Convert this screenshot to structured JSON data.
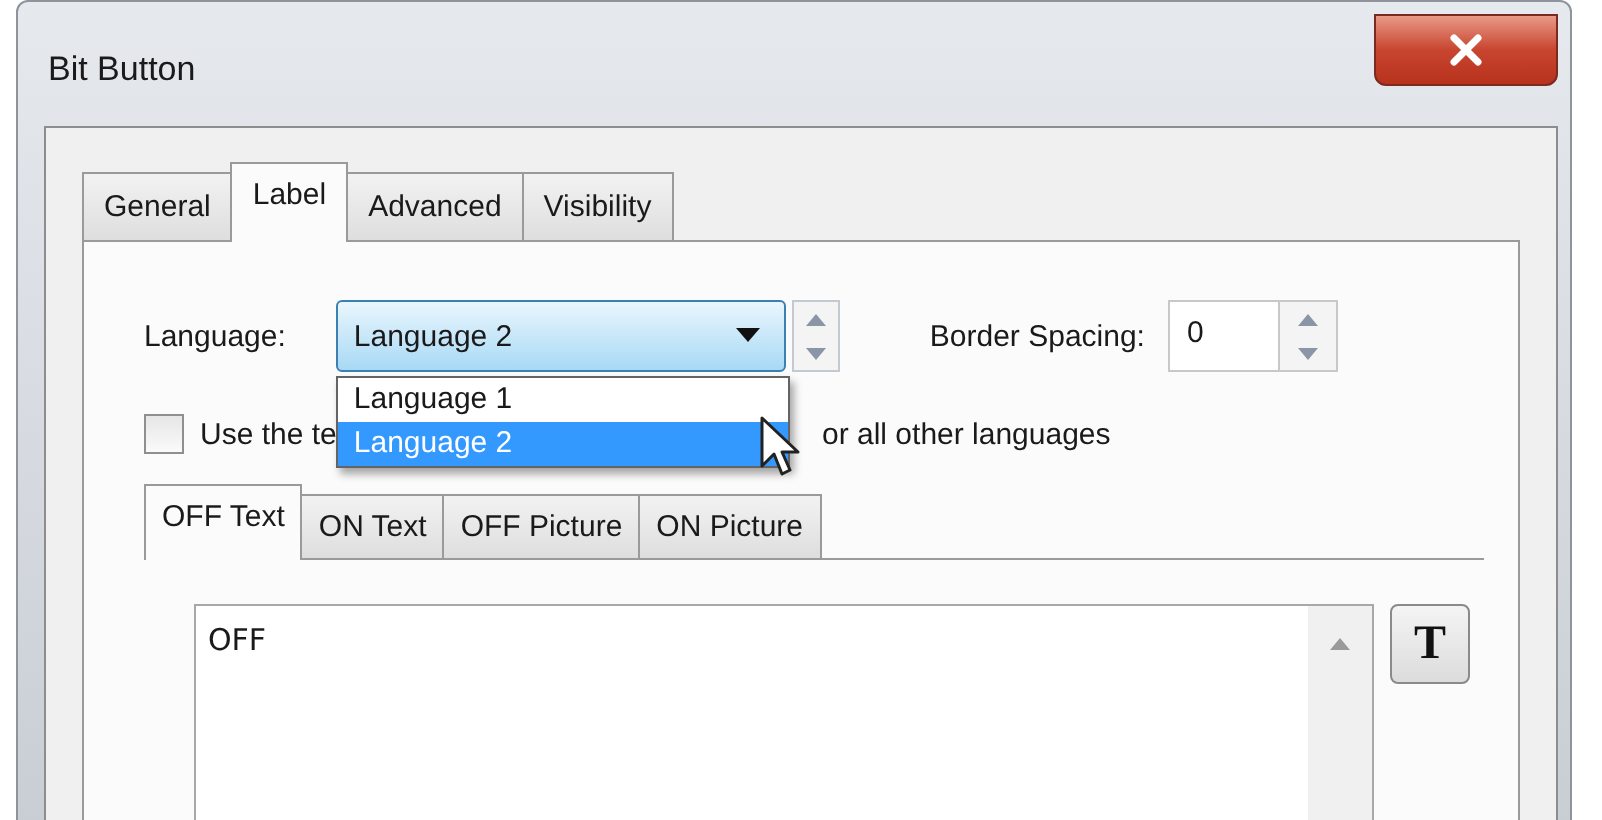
{
  "window": {
    "title": "Bit Button"
  },
  "tabs": [
    {
      "label": "General",
      "selected": false
    },
    {
      "label": "Label",
      "selected": true
    },
    {
      "label": "Advanced",
      "selected": false
    },
    {
      "label": "Visibility",
      "selected": false
    }
  ],
  "language": {
    "label": "Language:",
    "value": "Language 2",
    "expanded": true,
    "options": [
      {
        "label": "Language 1",
        "selected": false
      },
      {
        "label": "Language 2",
        "selected": true
      }
    ]
  },
  "border_spacing": {
    "label": "Border Spacing:",
    "value": "0"
  },
  "use_text_checkbox": {
    "label_start": "Use the te",
    "label_end": "or all other languages",
    "checked": false
  },
  "text_tabs": [
    {
      "label": "OFF Text",
      "selected": true
    },
    {
      "label": "ON Text",
      "selected": false
    },
    {
      "label": "OFF Picture",
      "selected": false
    },
    {
      "label": "ON Picture",
      "selected": false
    }
  ],
  "text_editor": {
    "value": "OFF"
  },
  "font_button": {
    "label": "T"
  }
}
